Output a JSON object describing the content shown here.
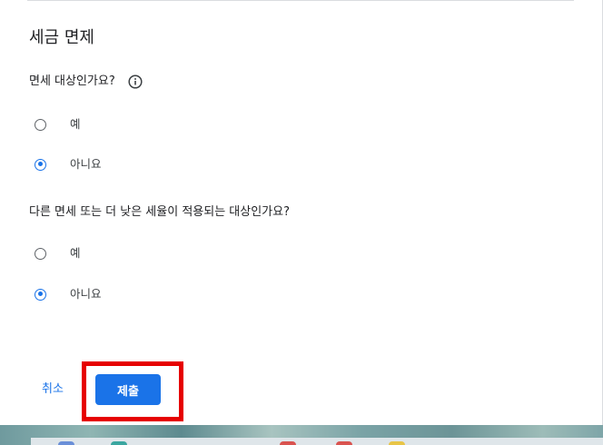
{
  "section": {
    "title": "세금 면제"
  },
  "questions": [
    {
      "text": "면세 대상인가요?",
      "has_info_icon": true,
      "options": [
        {
          "label": "예",
          "selected": false
        },
        {
          "label": "아니요",
          "selected": true
        }
      ]
    },
    {
      "text": "다른 면세 또는 더 낮은 세율이 적용되는 대상인가요?",
      "has_info_icon": false,
      "options": [
        {
          "label": "예",
          "selected": false
        },
        {
          "label": "아니요",
          "selected": true
        }
      ]
    }
  ],
  "actions": {
    "cancel_label": "취소",
    "submit_label": "제출"
  },
  "colors": {
    "accent": "#1a73e8",
    "highlight": "#e60000",
    "text": "#202124"
  },
  "icons": {
    "info": "info-icon"
  }
}
